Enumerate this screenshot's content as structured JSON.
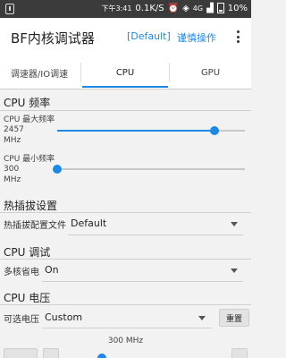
{
  "status_bar": {
    "label": "下午3:41",
    "speed": "0.1K/S",
    "network": "4G",
    "battery": "10%",
    "icons": [
      "app-icon",
      "alarm-icon",
      "wifi-icon",
      "signal-icon",
      "battery-icon"
    ]
  },
  "app_bar": {
    "title": "BF内核调试器",
    "profile": "[Default]",
    "caution": "谨慎操作",
    "more_icon": "more-vert-icon"
  },
  "tabs": [
    {
      "label": "调速器/IO调速"
    },
    {
      "label": "CPU"
    },
    {
      "label": "GPU"
    }
  ],
  "active_tab": "CPU",
  "cpu_freq": {
    "header": "CPU 频率",
    "max_label": "CPU 最大频率",
    "max_value": "2457",
    "max_unit": "MHz",
    "max_level": 0.84,
    "min_label": "CPU 最小频率",
    "min_value": "300",
    "min_unit": "MHz",
    "min_level": 0.0
  },
  "hotplug": {
    "header": "热插拔设置",
    "profile_label": "热插拔配置文件",
    "profile_value": "Default"
  },
  "cpu_tune": {
    "header": "CPU 调试",
    "multicore_label": "多核省电",
    "multicore_value": "On"
  },
  "cpu_voltage": {
    "header": "CPU 电压",
    "voltage_label": "可选电压",
    "voltage_value": "Custom",
    "reset_label": "重置",
    "freq_label": "300 MHz"
  },
  "colors": {
    "accent": "#1e88e5",
    "status_bar": "#3b3b3b",
    "background": "#f2f2f2"
  }
}
